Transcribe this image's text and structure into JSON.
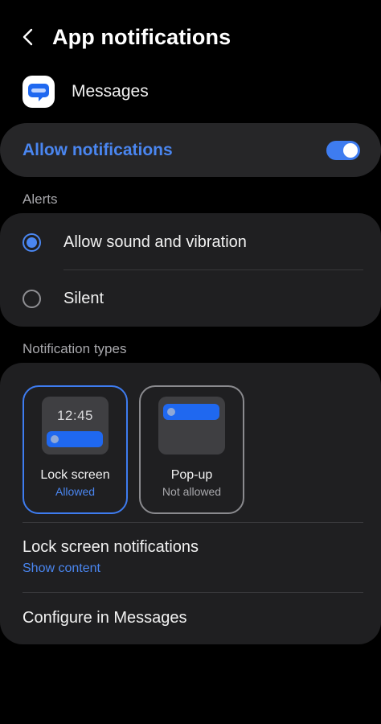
{
  "header": {
    "title": "App notifications"
  },
  "app": {
    "name": "Messages"
  },
  "allow": {
    "label": "Allow notifications",
    "enabled": true
  },
  "alerts": {
    "section_label": "Alerts",
    "options": [
      {
        "label": "Allow sound and vibration",
        "selected": true
      },
      {
        "label": "Silent",
        "selected": false
      }
    ]
  },
  "types": {
    "section_label": "Notification types",
    "tiles": [
      {
        "title": "Lock screen",
        "status": "Allowed",
        "preview_time": "12:45",
        "selected": true
      },
      {
        "title": "Pop-up",
        "status": "Not allowed",
        "selected": false
      }
    ]
  },
  "lock_screen": {
    "title": "Lock screen notifications",
    "subtitle": "Show content"
  },
  "configure": {
    "title": "Configure in Messages"
  },
  "colors": {
    "accent": "#4a86f0",
    "card": "#1f1f21",
    "background": "#000000"
  },
  "icons": {
    "back": "chevron-left-icon",
    "app": "messages-app-icon"
  }
}
